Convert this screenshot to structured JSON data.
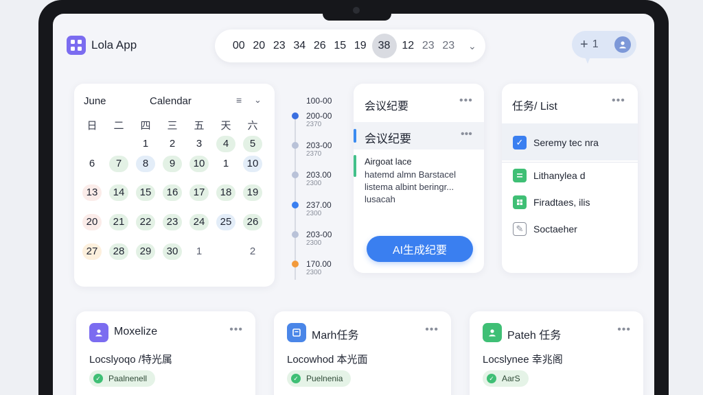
{
  "app": {
    "title": "Lola App"
  },
  "timebar": {
    "segments": [
      "00",
      "20",
      "23",
      "34",
      "26",
      "15",
      "19",
      "38",
      "12",
      "23",
      "23"
    ],
    "selected_index": 7
  },
  "notifications": {
    "count": "1"
  },
  "calendar": {
    "month": "June",
    "title": "Calendar",
    "weekdays": [
      "日",
      "二",
      "四",
      "三",
      "五",
      "天",
      "六"
    ],
    "rows": [
      [
        null,
        null,
        null,
        "1",
        "2",
        "3",
        "4",
        "5"
      ],
      [
        "6",
        "7",
        "8",
        "9",
        "10",
        "1",
        "10"
      ],
      [
        "13",
        "14",
        "15",
        "16",
        "17",
        "18",
        "19"
      ],
      [
        "20",
        "21",
        "22",
        "23",
        "24",
        "25",
        "26"
      ],
      [
        "27",
        "28",
        "29",
        "30",
        "1",
        "",
        "2"
      ]
    ]
  },
  "timeline": {
    "header": "100-00",
    "entries": [
      {
        "primary": "200-00",
        "secondary": "2370",
        "color": "#3a6fe0"
      },
      {
        "primary": "203-00",
        "secondary": "2370",
        "color": "#b9c2d8"
      },
      {
        "primary": "203.00",
        "secondary": "2300",
        "color": "#b9c2d8"
      },
      {
        "primary": "237.00",
        "secondary": "2300",
        "color": "#3a7ff0"
      },
      {
        "primary": "203-00",
        "secondary": "2300",
        "color": "#b9c2d8"
      },
      {
        "primary": "170.00",
        "secondary": "2300",
        "color": "#f29a3c"
      }
    ]
  },
  "meeting_notes": {
    "title": "会议纪要",
    "subtitle": "会议纪要",
    "heading": "Airgoat lace",
    "lines": [
      "hatemd almn Barstacel",
      "listema albint beringr...",
      "lusacah"
    ],
    "ai_button": "AI生成纪要"
  },
  "task_list": {
    "title": "任务/ List",
    "items": [
      {
        "label": "Seremy tec nra",
        "state": "checked"
      },
      {
        "label": "Lithanylea d",
        "state": "green"
      },
      {
        "label": "Firadtaes, ilis",
        "state": "green"
      },
      {
        "label": "Soctaeher",
        "state": "outline"
      }
    ]
  },
  "cards": [
    {
      "title": "Moxelize",
      "subtitle": "Locslyoqo /特光属",
      "badge": "Paalnenell",
      "icon_color": "#7b6cf0",
      "icon": "person-icon"
    },
    {
      "title": "Marh任务",
      "subtitle": "Locowhod 本光面",
      "badge": "Puelnenia",
      "icon_color": "#4a86e8",
      "icon": "window-icon"
    },
    {
      "title": "Pateh 任务",
      "subtitle": "Locslynee 幸兆阁",
      "badge": "AarS",
      "icon_color": "#3fbf75",
      "icon": "person-icon"
    }
  ],
  "icons": {
    "app": "grid-icon",
    "menu": "list-icon",
    "chevron": "chevron-down-icon",
    "more": "more-dots-icon",
    "plus": "plus-icon",
    "avatar": "user-avatar-icon"
  }
}
